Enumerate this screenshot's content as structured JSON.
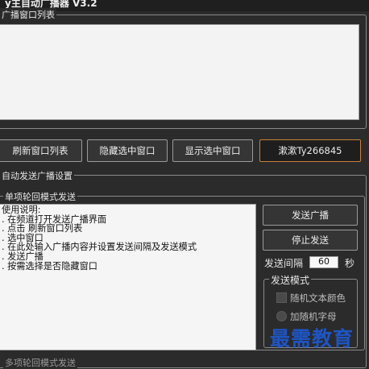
{
  "window": {
    "title": "y主自动广播器 V3.2"
  },
  "window_list": {
    "group_label": "广播窗口列表"
  },
  "toolbar": {
    "refresh_label": "刷新窗口列表",
    "hide_label": "隐藏选中窗口",
    "show_label": "显示选中窗口",
    "credit_label": "漱漱Ty266845"
  },
  "auto_settings": {
    "group_label": "自动发送广播设置"
  },
  "single_mode": {
    "group_label": "单项轮回模式发送",
    "instructions": [
      "使用说明:",
      ". 在频道打开发送广播界面",
      ". 点击 刷新窗口列表",
      ". 选中窗口",
      ". 在此处输入广播内容并设置发送间隔及发送模式",
      ". 发送广播",
      ". 按需选择是否隐藏窗口"
    ],
    "send_label": "发送广播",
    "stop_label": "停止发送",
    "interval_label": "发送间隔",
    "interval_value": "60",
    "interval_unit": "秒",
    "send_mode": {
      "group_label": "发送模式",
      "random_color_label": "随机文本颜色",
      "random_char_label": "加随机字母"
    }
  },
  "next_section": {
    "group_label": "多项轮回模式发送"
  },
  "watermark": {
    "text": "最需教育"
  }
}
